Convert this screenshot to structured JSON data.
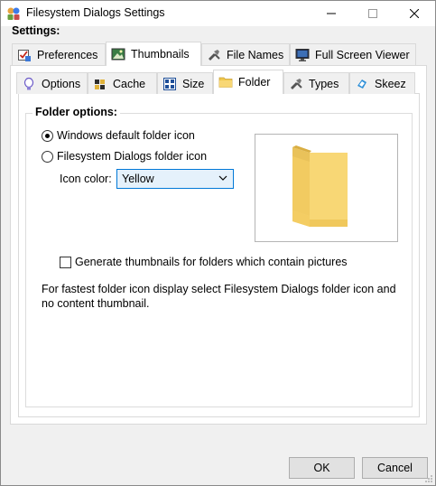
{
  "window": {
    "title": "Filesystem Dialogs Settings",
    "settings_label": "Settings:"
  },
  "outer_tabs": [
    {
      "label": "Preferences",
      "icon": "preferences-checkbox-icon"
    },
    {
      "label": "Thumbnails",
      "icon": "thumbnails-image-icon",
      "active": true
    },
    {
      "label": "File Names",
      "icon": "file-names-tool-icon"
    },
    {
      "label": "Full Screen Viewer",
      "icon": "monitor-icon"
    }
  ],
  "inner_tabs": [
    {
      "label": "Options",
      "icon": "lightbulb-icon"
    },
    {
      "label": "Cache",
      "icon": "cache-icon"
    },
    {
      "label": "Size",
      "icon": "grid-size-icon"
    },
    {
      "label": "Folder",
      "icon": "folder-icon",
      "active": true
    },
    {
      "label": "Types",
      "icon": "types-icon"
    },
    {
      "label": "Skeez",
      "icon": "skeez-icon"
    }
  ],
  "folder_options": {
    "title": "Folder options:",
    "radio_windows": "Windows default folder icon",
    "radio_fsd": "Filesystem Dialogs folder icon",
    "selected": "windows",
    "icon_color_label": "Icon color:",
    "icon_color_value": "Yellow",
    "checkbox_label": "Generate thumbnails for folders which contain pictures",
    "checkbox_checked": false,
    "info_text": "For fastest folder icon display select Filesystem Dialogs folder icon and no content thumbnail."
  },
  "buttons": {
    "ok": "OK",
    "cancel": "Cancel"
  },
  "colors": {
    "accent": "#0078d7",
    "folder_yellow": "#f8d775"
  }
}
